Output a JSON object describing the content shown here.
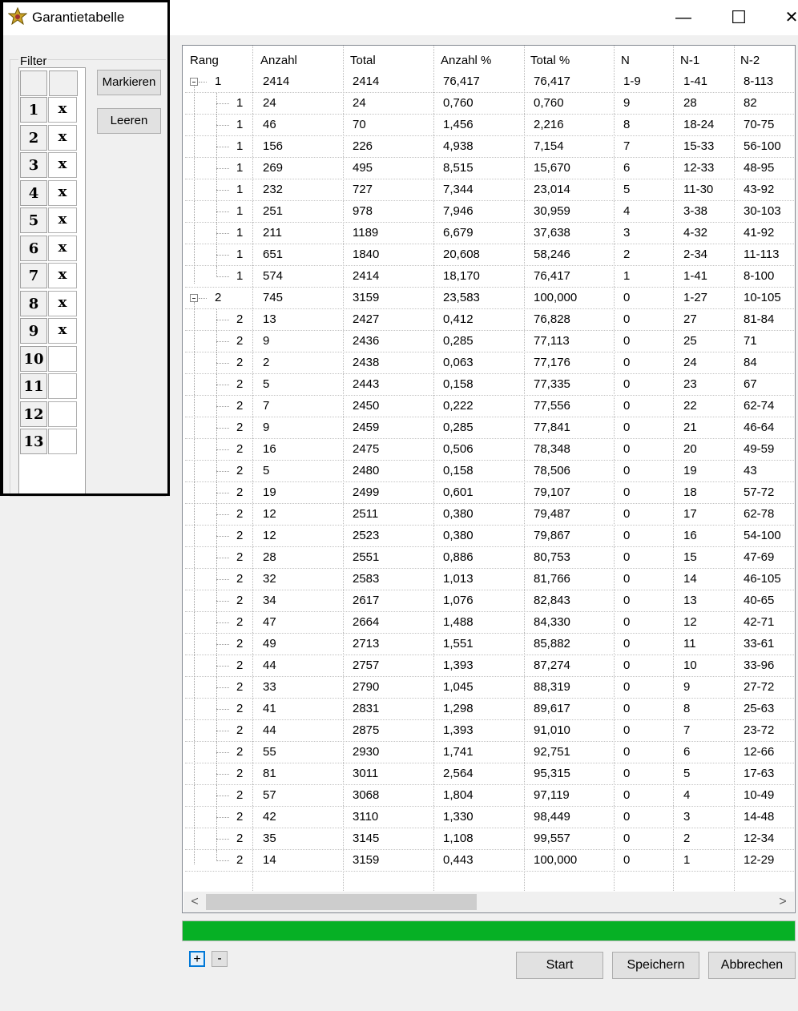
{
  "window": {
    "title": "Garantietabelle",
    "minimize_glyph": "—",
    "maximize_glyph": "☐",
    "close_glyph": "✕"
  },
  "filter": {
    "legend": "Filter",
    "rows": [
      {
        "num": "1",
        "val": "x"
      },
      {
        "num": "2",
        "val": "x"
      },
      {
        "num": "3",
        "val": "x"
      },
      {
        "num": "4",
        "val": "x"
      },
      {
        "num": "5",
        "val": "x"
      },
      {
        "num": "6",
        "val": "x"
      },
      {
        "num": "7",
        "val": "x"
      },
      {
        "num": "8",
        "val": "x"
      },
      {
        "num": "9",
        "val": "x"
      },
      {
        "num": "10",
        "val": ""
      },
      {
        "num": "11",
        "val": ""
      },
      {
        "num": "12",
        "val": ""
      },
      {
        "num": "13",
        "val": ""
      }
    ],
    "mark_button": "Markieren",
    "clear_button": "Leeren"
  },
  "table": {
    "columns": [
      "Rang",
      "Anzahl",
      "Total",
      "Anzahl %",
      "Total %",
      "N",
      "N-1",
      "N-2"
    ],
    "rows": [
      {
        "level": 0,
        "cells": [
          "1",
          "2414",
          "2414",
          "76,417",
          "76,417",
          "1-9",
          "1-41",
          "8-113"
        ]
      },
      {
        "level": 1,
        "cells": [
          "1",
          "24",
          "24",
          "0,760",
          "0,760",
          "9",
          "28",
          "82"
        ]
      },
      {
        "level": 1,
        "cells": [
          "1",
          "46",
          "70",
          "1,456",
          "2,216",
          "8",
          "18-24",
          "70-75"
        ]
      },
      {
        "level": 1,
        "cells": [
          "1",
          "156",
          "226",
          "4,938",
          "7,154",
          "7",
          "15-33",
          "56-100"
        ]
      },
      {
        "level": 1,
        "cells": [
          "1",
          "269",
          "495",
          "8,515",
          "15,670",
          "6",
          "12-33",
          "48-95"
        ]
      },
      {
        "level": 1,
        "cells": [
          "1",
          "232",
          "727",
          "7,344",
          "23,014",
          "5",
          "11-30",
          "43-92"
        ]
      },
      {
        "level": 1,
        "cells": [
          "1",
          "251",
          "978",
          "7,946",
          "30,959",
          "4",
          "3-38",
          "30-103"
        ]
      },
      {
        "level": 1,
        "cells": [
          "1",
          "211",
          "1189",
          "6,679",
          "37,638",
          "3",
          "4-32",
          "41-92"
        ]
      },
      {
        "level": 1,
        "cells": [
          "1",
          "651",
          "1840",
          "20,608",
          "58,246",
          "2",
          "2-34",
          "11-113"
        ]
      },
      {
        "level": 1,
        "cells": [
          "1",
          "574",
          "2414",
          "18,170",
          "76,417",
          "1",
          "1-41",
          "8-100"
        ]
      },
      {
        "level": 0,
        "cells": [
          "2",
          "745",
          "3159",
          "23,583",
          "100,000",
          "0",
          "1-27",
          "10-105"
        ]
      },
      {
        "level": 1,
        "cells": [
          "2",
          "13",
          "2427",
          "0,412",
          "76,828",
          "0",
          "27",
          "81-84"
        ]
      },
      {
        "level": 1,
        "cells": [
          "2",
          "9",
          "2436",
          "0,285",
          "77,113",
          "0",
          "25",
          "71"
        ]
      },
      {
        "level": 1,
        "cells": [
          "2",
          "2",
          "2438",
          "0,063",
          "77,176",
          "0",
          "24",
          "84"
        ]
      },
      {
        "level": 1,
        "cells": [
          "2",
          "5",
          "2443",
          "0,158",
          "77,335",
          "0",
          "23",
          "67"
        ]
      },
      {
        "level": 1,
        "cells": [
          "2",
          "7",
          "2450",
          "0,222",
          "77,556",
          "0",
          "22",
          "62-74"
        ]
      },
      {
        "level": 1,
        "cells": [
          "2",
          "9",
          "2459",
          "0,285",
          "77,841",
          "0",
          "21",
          "46-64"
        ]
      },
      {
        "level": 1,
        "cells": [
          "2",
          "16",
          "2475",
          "0,506",
          "78,348",
          "0",
          "20",
          "49-59"
        ]
      },
      {
        "level": 1,
        "cells": [
          "2",
          "5",
          "2480",
          "0,158",
          "78,506",
          "0",
          "19",
          "43"
        ]
      },
      {
        "level": 1,
        "cells": [
          "2",
          "19",
          "2499",
          "0,601",
          "79,107",
          "0",
          "18",
          "57-72"
        ]
      },
      {
        "level": 1,
        "cells": [
          "2",
          "12",
          "2511",
          "0,380",
          "79,487",
          "0",
          "17",
          "62-78"
        ]
      },
      {
        "level": 1,
        "cells": [
          "2",
          "12",
          "2523",
          "0,380",
          "79,867",
          "0",
          "16",
          "54-100"
        ]
      },
      {
        "level": 1,
        "cells": [
          "2",
          "28",
          "2551",
          "0,886",
          "80,753",
          "0",
          "15",
          "47-69"
        ]
      },
      {
        "level": 1,
        "cells": [
          "2",
          "32",
          "2583",
          "1,013",
          "81,766",
          "0",
          "14",
          "46-105"
        ]
      },
      {
        "level": 1,
        "cells": [
          "2",
          "34",
          "2617",
          "1,076",
          "82,843",
          "0",
          "13",
          "40-65"
        ]
      },
      {
        "level": 1,
        "cells": [
          "2",
          "47",
          "2664",
          "1,488",
          "84,330",
          "0",
          "12",
          "42-71"
        ]
      },
      {
        "level": 1,
        "cells": [
          "2",
          "49",
          "2713",
          "1,551",
          "85,882",
          "0",
          "11",
          "33-61"
        ]
      },
      {
        "level": 1,
        "cells": [
          "2",
          "44",
          "2757",
          "1,393",
          "87,274",
          "0",
          "10",
          "33-96"
        ]
      },
      {
        "level": 1,
        "cells": [
          "2",
          "33",
          "2790",
          "1,045",
          "88,319",
          "0",
          "9",
          "27-72"
        ]
      },
      {
        "level": 1,
        "cells": [
          "2",
          "41",
          "2831",
          "1,298",
          "89,617",
          "0",
          "8",
          "25-63"
        ]
      },
      {
        "level": 1,
        "cells": [
          "2",
          "44",
          "2875",
          "1,393",
          "91,010",
          "0",
          "7",
          "23-72"
        ]
      },
      {
        "level": 1,
        "cells": [
          "2",
          "55",
          "2930",
          "1,741",
          "92,751",
          "0",
          "6",
          "12-66"
        ]
      },
      {
        "level": 1,
        "cells": [
          "2",
          "81",
          "3011",
          "2,564",
          "95,315",
          "0",
          "5",
          "17-63"
        ]
      },
      {
        "level": 1,
        "cells": [
          "2",
          "57",
          "3068",
          "1,804",
          "97,119",
          "0",
          "4",
          "10-49"
        ]
      },
      {
        "level": 1,
        "cells": [
          "2",
          "42",
          "3110",
          "1,330",
          "98,449",
          "0",
          "3",
          "14-48"
        ]
      },
      {
        "level": 1,
        "cells": [
          "2",
          "35",
          "3145",
          "1,108",
          "99,557",
          "0",
          "2",
          "12-34"
        ]
      },
      {
        "level": 1,
        "cells": [
          "2",
          "14",
          "3159",
          "0,443",
          "100,000",
          "0",
          "1",
          "12-29"
        ]
      }
    ]
  },
  "scrollbar": {
    "left_arrow": "<",
    "right_arrow": ">",
    "position_fraction": 0.0
  },
  "progress": {
    "fraction": 1.0,
    "color": "#06b025"
  },
  "tree_buttons": {
    "expand": "+",
    "collapse": "-"
  },
  "actions": {
    "start": "Start",
    "save": "Speichern",
    "cancel": "Abbrechen"
  }
}
